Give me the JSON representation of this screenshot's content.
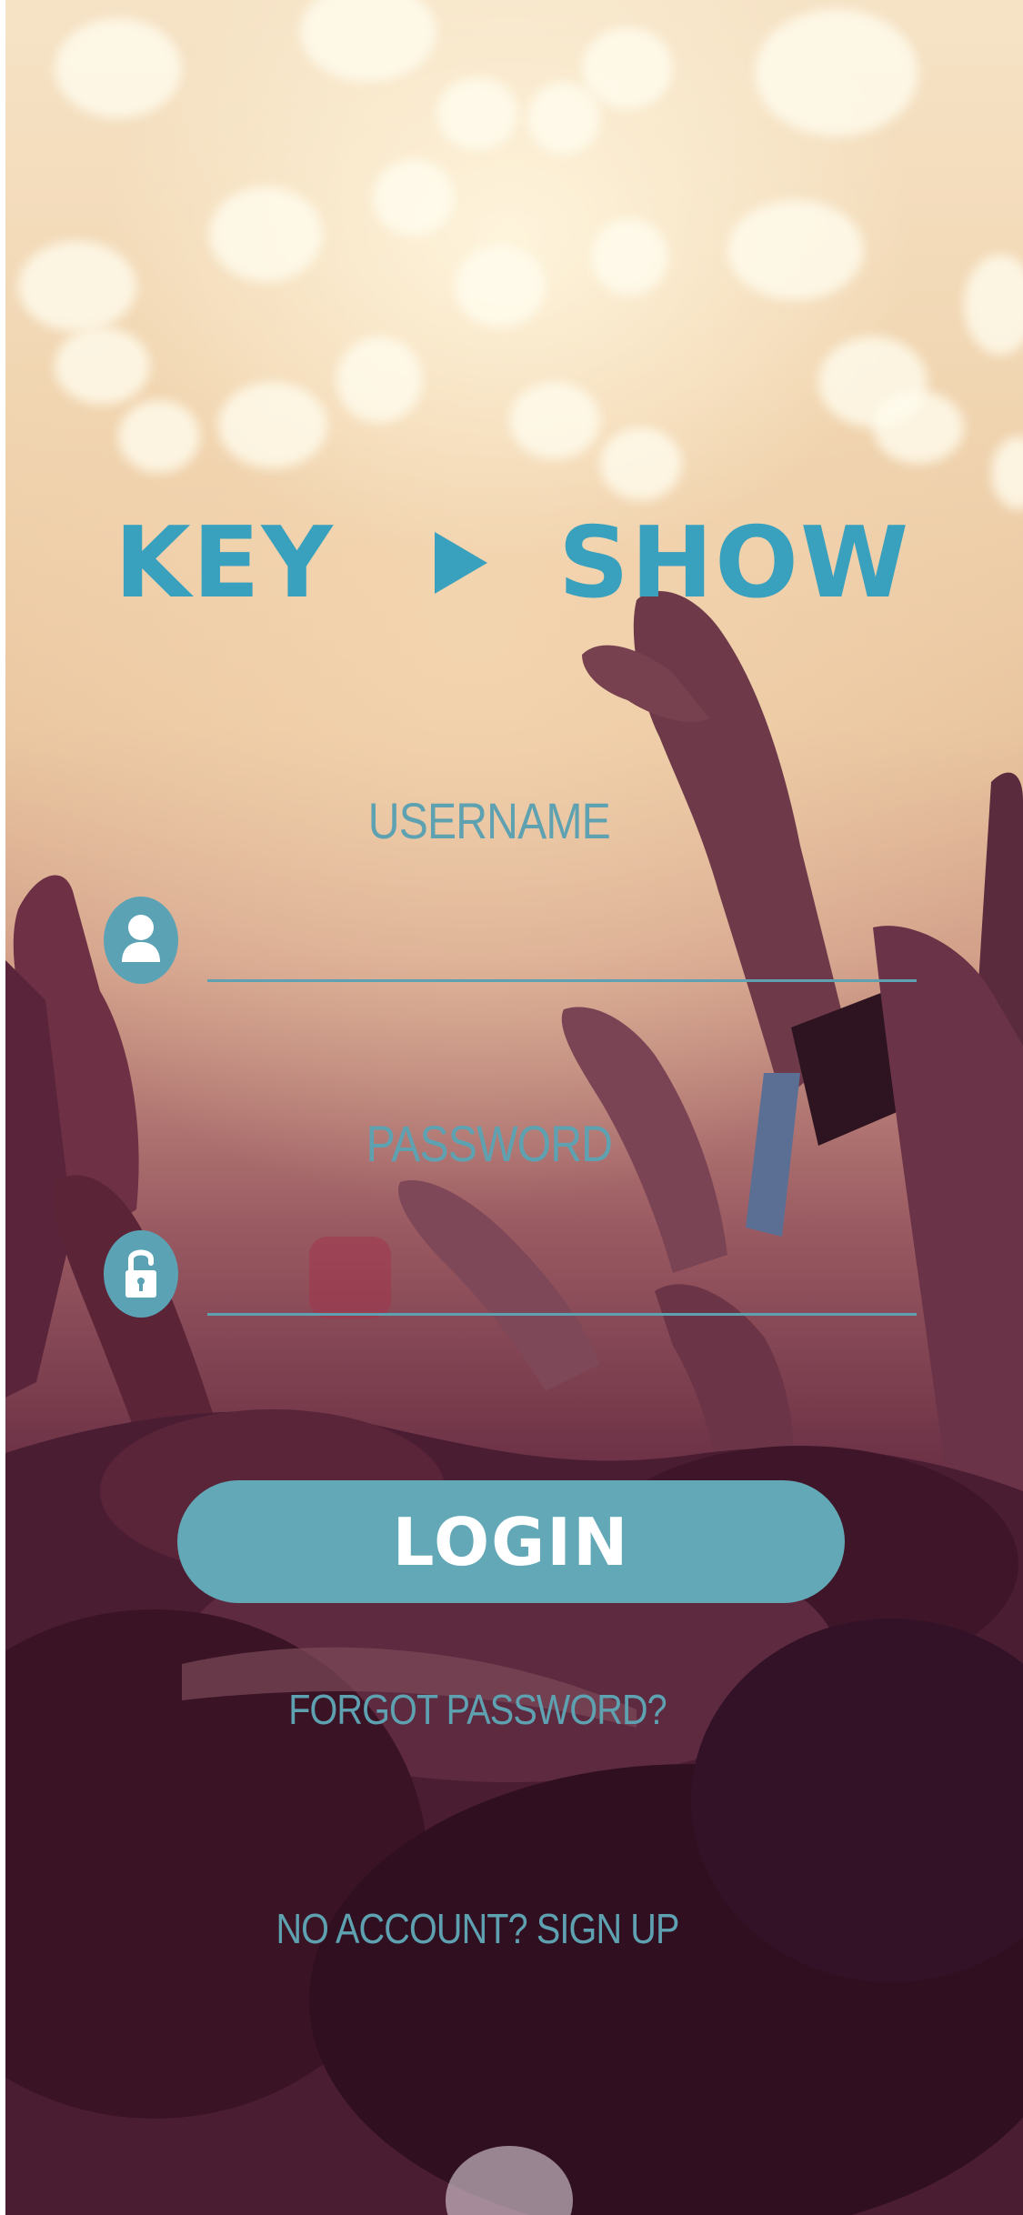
{
  "app": {
    "logo": {
      "word_left": "KEY",
      "word_right": "SHOW",
      "icon": "play-icon"
    },
    "form": {
      "username_label": "USERNAME",
      "password_label": "PASSWORD",
      "username_icon": "user-icon",
      "password_icon": "unlock-icon",
      "username_value": "",
      "password_value": ""
    },
    "login_button_label": "LOGIN",
    "forgot_password_link": "FORGOT PASSWORD?",
    "signup_link": "NO ACCOUNT? SIGN UP"
  },
  "colors": {
    "accent": "#39a1be",
    "button": "#62a8b6",
    "field_text": "#5ea2b2",
    "button_text": "#ffffff"
  }
}
